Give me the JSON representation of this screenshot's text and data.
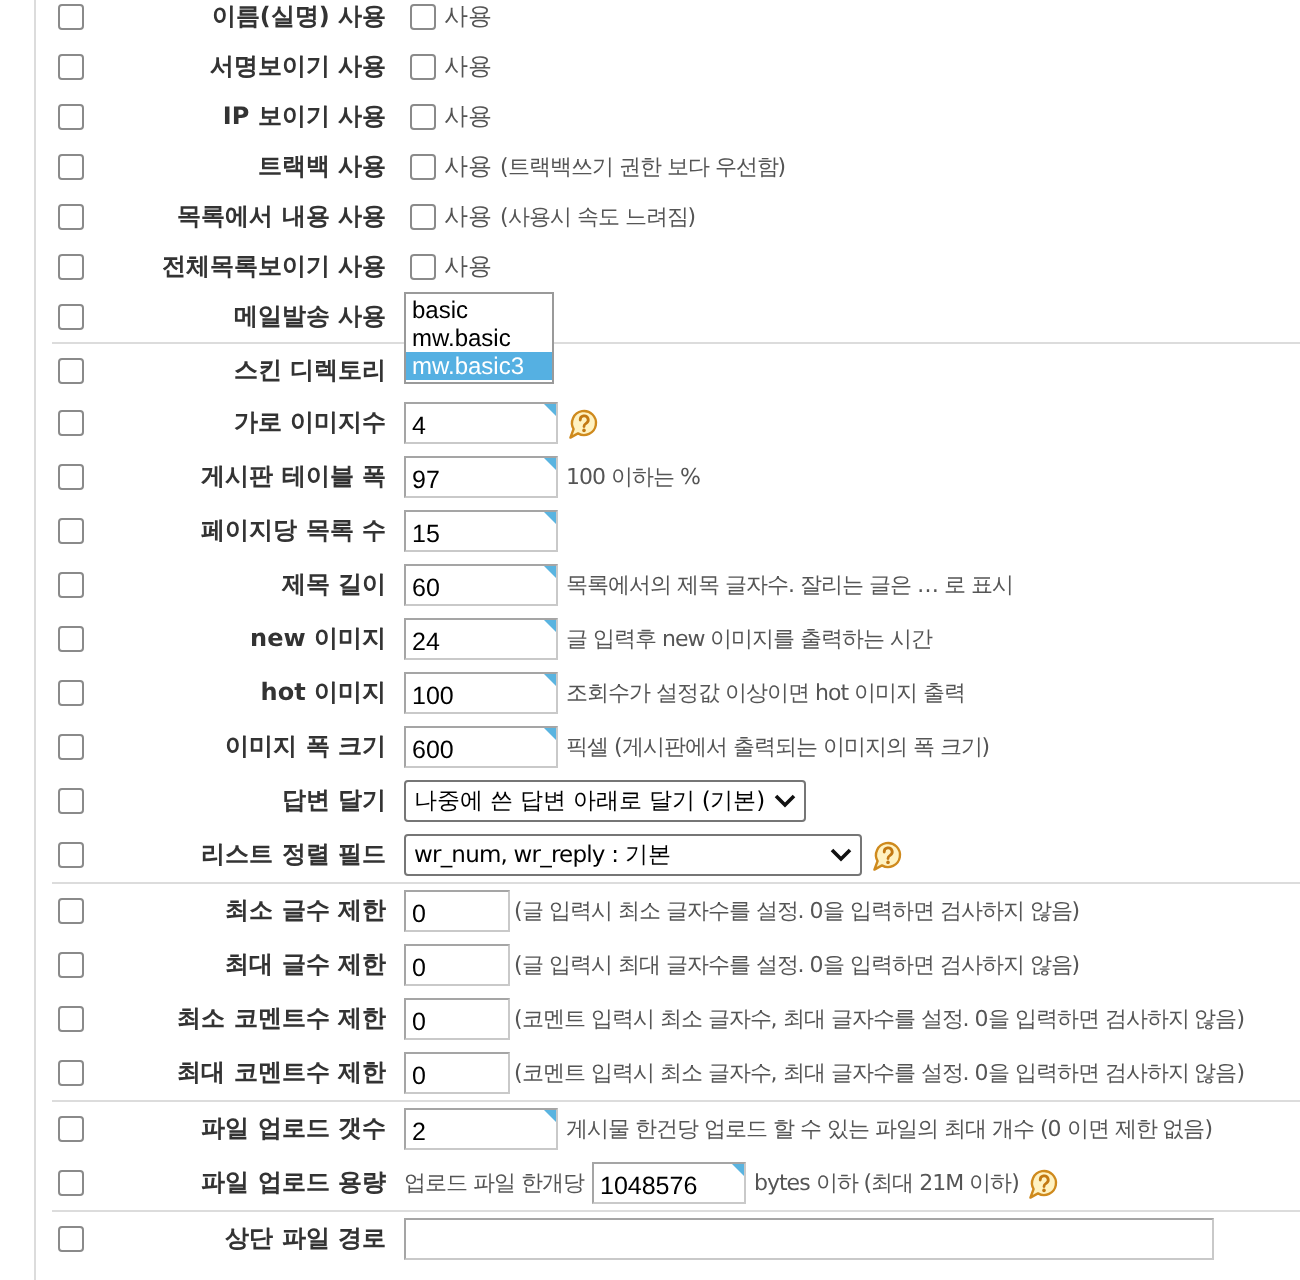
{
  "sections": [
    {
      "rows": [
        {
          "label": "이름(실명) 사용",
          "checked": false,
          "field": {
            "kind": "checkbox",
            "label": "사용",
            "checked": false
          }
        },
        {
          "label": "서명보이기 사용",
          "checked": false,
          "field": {
            "kind": "checkbox",
            "label": "사용",
            "checked": false
          }
        },
        {
          "label": "IP 보이기 사용",
          "checked": false,
          "field": {
            "kind": "checkbox",
            "label": "사용",
            "checked": false
          }
        },
        {
          "label": "트랙백 사용",
          "checked": false,
          "field": {
            "kind": "checkbox",
            "label": "사용",
            "checked": false
          },
          "note": "(트랙백쓰기 권한 보다 우선함)"
        },
        {
          "label": "목록에서 내용 사용",
          "checked": false,
          "field": {
            "kind": "checkbox",
            "label": "사용",
            "checked": false
          },
          "note": "(사용시 속도 느려짐)"
        },
        {
          "label": "전체목록보이기 사용",
          "checked": false,
          "field": {
            "kind": "checkbox",
            "label": "사용",
            "checked": false
          }
        },
        {
          "label": "메일발송 사용",
          "checked": false
        }
      ]
    },
    {
      "rows": [
        {
          "label": "스킨 디렉토리",
          "checked": false,
          "field": {
            "kind": "listbox",
            "options": [
              {
                "label": "basic",
                "selected": false
              },
              {
                "label": "mw.basic",
                "selected": false
              },
              {
                "label": "mw.basic3",
                "selected": true
              }
            ]
          }
        },
        {
          "label": "가로 이미지수",
          "checked": false,
          "field": {
            "kind": "text",
            "value": "4"
          },
          "help": true
        },
        {
          "label": "게시판 테이블 폭",
          "checked": false,
          "field": {
            "kind": "text",
            "value": "97"
          },
          "note": "100 이하는 %"
        },
        {
          "label": "페이지당 목록 수",
          "checked": false,
          "field": {
            "kind": "text",
            "value": "15"
          }
        },
        {
          "label": "제목 길이",
          "checked": false,
          "field": {
            "kind": "text",
            "value": "60"
          },
          "note": "목록에서의 제목 글자수. 잘리는 글은 … 로 표시"
        },
        {
          "label": "new 이미지",
          "checked": false,
          "field": {
            "kind": "text",
            "value": "24"
          },
          "note": "글 입력후 new 이미지를 출력하는 시간"
        },
        {
          "label": "hot 이미지",
          "checked": false,
          "field": {
            "kind": "text",
            "value": "100"
          },
          "note": "조회수가 설정값 이상이면 hot 이미지 출력"
        },
        {
          "label": "이미지 폭 크기",
          "checked": false,
          "field": {
            "kind": "text",
            "value": "600"
          },
          "note": "픽셀 (게시판에서 출력되는 이미지의 폭 크기)"
        },
        {
          "label": "답변 달기",
          "checked": false,
          "field": {
            "kind": "select",
            "value": "나중에 쓴 답변 아래로 달기 (기본)"
          }
        },
        {
          "label": "리스트 정렬 필드",
          "checked": false,
          "field": {
            "kind": "wide_select",
            "value": "wr_num, wr_reply : 기본"
          },
          "help": true
        }
      ]
    },
    {
      "rows": [
        {
          "label": "최소 글수 제한",
          "checked": false,
          "field": {
            "kind": "short_text",
            "value": "0"
          },
          "note": "(글 입력시 최소 글자수를 설정. 0을 입력하면 검사하지 않음)"
        },
        {
          "label": "최대 글수 제한",
          "checked": false,
          "field": {
            "kind": "short_text",
            "value": "0"
          },
          "note": "(글 입력시 최대 글자수를 설정. 0을 입력하면 검사하지 않음)"
        },
        {
          "label": "최소 코멘트수 제한",
          "checked": false,
          "field": {
            "kind": "short_text",
            "value": "0"
          },
          "note": "(코멘트 입력시 최소 글자수, 최대 글자수를 설정. 0을 입력하면 검사하지 않음)"
        },
        {
          "label": "최대 코멘트수 제한",
          "checked": false,
          "field": {
            "kind": "short_text",
            "value": "0"
          },
          "note": "(코멘트 입력시 최소 글자수, 최대 글자수를 설정. 0을 입력하면 검사하지 않음)"
        }
      ]
    },
    {
      "rows": [
        {
          "label": "파일 업로드 갯수",
          "checked": false,
          "field": {
            "kind": "text",
            "value": "2"
          },
          "note": "게시물 한건당 업로드 할 수 있는 파일의 최대 개수 (0 이면 제한 없음)"
        },
        {
          "label": "파일 업로드 용량",
          "checked": false,
          "prefix": "업로드 파일 한개당",
          "field": {
            "kind": "text",
            "value": "1048576"
          },
          "note": "bytes 이하 (최대 21M 이하)",
          "help": true
        }
      ]
    },
    {
      "rows": [
        {
          "label": "상단 파일 경로",
          "checked": false,
          "field": {
            "kind": "long_text"
          }
        }
      ]
    }
  ]
}
